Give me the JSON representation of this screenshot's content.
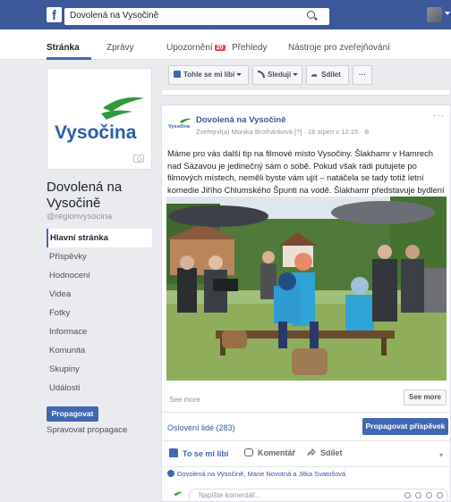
{
  "topbar": {
    "brand_letter": "f",
    "search_value": "Dovolená na Vysočině"
  },
  "tabs": [
    {
      "label": "Stránka",
      "active": true
    },
    {
      "label": "Zprávy"
    },
    {
      "label": "Upozornění",
      "badge": "20"
    },
    {
      "label": "Přehledy"
    },
    {
      "label": "Nástroje pro zveřejňování"
    }
  ],
  "colors": {
    "brand": "#3b5998",
    "accent": "#4267b2",
    "logo_blue": "#2b5cab",
    "logo_green": "#2f9a3a"
  },
  "page": {
    "logo_text": "Vysočina",
    "name": "Dovolená na Vysočině",
    "handle": "@regionvysocina"
  },
  "nav": [
    {
      "label": "Hlavní stránka",
      "active": true
    },
    {
      "label": "Příspěvky"
    },
    {
      "label": "Hodnocení"
    },
    {
      "label": "Videa"
    },
    {
      "label": "Fotky"
    },
    {
      "label": "Informace"
    },
    {
      "label": "Komunita"
    },
    {
      "label": "Skupiny"
    },
    {
      "label": "Události"
    }
  ],
  "promote": {
    "button": "Propagovat",
    "manage": "Spravovat propagace"
  },
  "actions": {
    "liked": "Tohle se mi líbí",
    "follow": "Sleduji",
    "share": "Sdílet",
    "more": "···"
  },
  "post": {
    "author": "Dovolená na Vysočině",
    "avatar_text": "Vysočina",
    "meta": "Zveřejnil(a) Monika Brothánková [?] · 16 srpen v 12:15 · ",
    "more": "···",
    "text": "Máme pro vás další tip na filmové místo Vysočiny. Šlakhamr v Hamrech nad Sázavou je jedinečný sám o sobě. Pokud však rádi putujete po filmových místech, neměli byste vám ujít – natáčela se tady totiž letní komedie Jiřího Chlumského Špunti na vodě. Šlakhamr představuje bydlení prarodičů.",
    "see_more_left": "See more",
    "see_more_btn": "See more",
    "invite": "Oslovení lidé (283)",
    "boost": "Propagovat příspěvek",
    "like": "To se mi líbí",
    "comment": "Komentář",
    "share": "Sdílet",
    "likers": "Dovolená na Vysočině, Marie Novotná a Jitka Svatošová",
    "comment_placeholder": "Napište komentář..."
  }
}
